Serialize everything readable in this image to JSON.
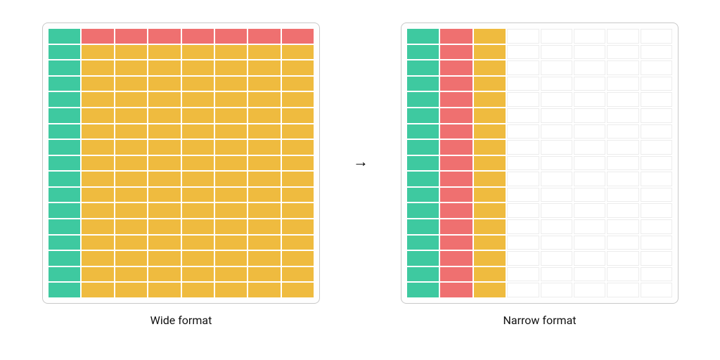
{
  "diagram": {
    "left_caption": "Wide format",
    "right_caption": "Narrow format",
    "arrow_glyph": "→"
  },
  "colors": {
    "green": "#3ec9a0",
    "red": "#ef7070",
    "yellow": "#efbb3f",
    "blank_border": "#ececec",
    "panel_border": "#c9c9c9"
  },
  "chart_data": [
    {
      "name": "wide-format",
      "type": "table",
      "title": "Wide format",
      "rows": 17,
      "cols": 8,
      "column_colors": [
        "green",
        "red",
        "red",
        "red",
        "red",
        "red",
        "red",
        "red"
      ],
      "row0_overrides": null,
      "body_color": "yellow",
      "first_col_color": "green",
      "header_row_color": "red",
      "header_row_first_cell": "green",
      "description": "17×8 grid. Row 0: col0 green, cols1–7 red. Rows 1–16: col0 green, cols1–7 yellow."
    },
    {
      "name": "narrow-format",
      "type": "table",
      "title": "Narrow format",
      "rows": 17,
      "cols": 8,
      "column_colors": [
        "green",
        "red",
        "yellow",
        "blank",
        "blank",
        "blank",
        "blank",
        "blank"
      ],
      "description": "17×8 grid. Every row: col0 green, col1 red, col2 yellow, cols3–7 blank white cells with light border."
    }
  ]
}
